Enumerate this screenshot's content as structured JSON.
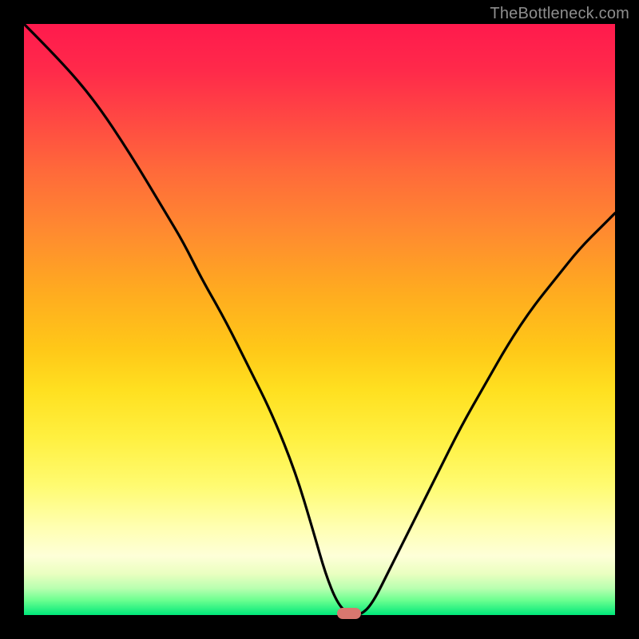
{
  "watermark": "TheBottleneck.com",
  "colors": {
    "frame": "#000000",
    "curve": "#000000",
    "marker": "#d9776f"
  },
  "chart_data": {
    "type": "line",
    "title": "",
    "xlabel": "",
    "ylabel": "",
    "xlim": [
      0,
      100
    ],
    "ylim": [
      0,
      100
    ],
    "grid": false,
    "legend": false,
    "series": [
      {
        "name": "bottleneck-curve",
        "x": [
          0,
          6,
          12,
          18,
          24,
          27,
          30,
          34,
          38,
          42,
          46,
          49,
          51,
          53,
          55,
          57,
          59,
          62,
          66,
          70,
          74,
          78,
          82,
          86,
          90,
          94,
          98,
          100
        ],
        "values": [
          100,
          94,
          87,
          78,
          68,
          63,
          57,
          50,
          42,
          34,
          24,
          14,
          7,
          2,
          0,
          0,
          2,
          8,
          16,
          24,
          32,
          39,
          46,
          52,
          57,
          62,
          66,
          68
        ]
      }
    ],
    "marker": {
      "x_start": 53,
      "x_end": 57,
      "y": 0,
      "label": "optimal-zone"
    }
  }
}
